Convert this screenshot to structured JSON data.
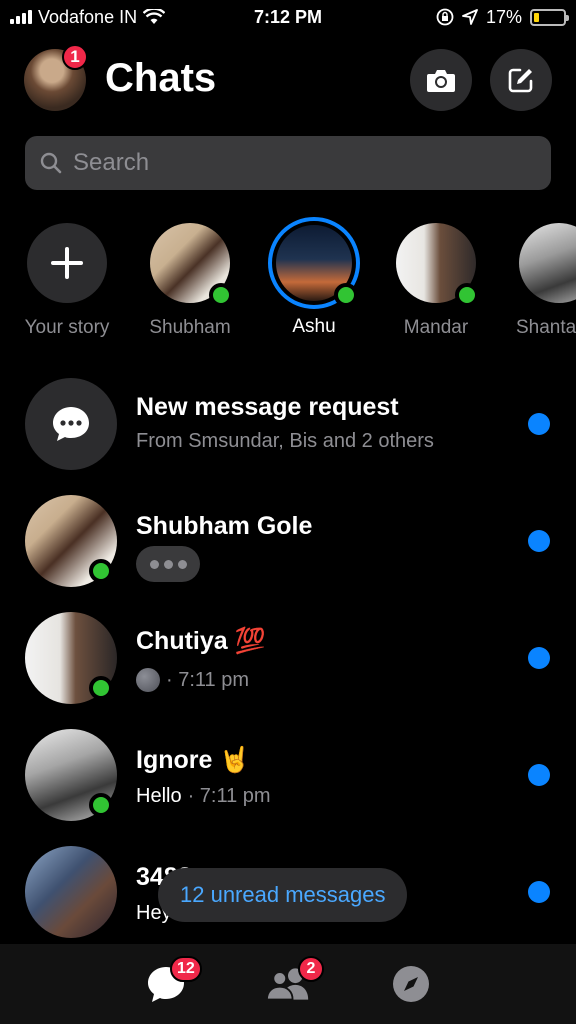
{
  "status_bar": {
    "carrier": "Vodafone IN",
    "time": "7:12 PM",
    "battery": "17%",
    "battery_level": 0.17
  },
  "header": {
    "title": "Chats",
    "profile_badge": "1"
  },
  "search": {
    "placeholder": "Search"
  },
  "stories": [
    {
      "label": "Your story"
    },
    {
      "label": "Shubham"
    },
    {
      "label": "Ashu"
    },
    {
      "label": "Mandar"
    },
    {
      "label": "Shanta"
    }
  ],
  "chats": [
    {
      "name": "New message request",
      "subtitle": "From Smsundar, Bis and 2 others"
    },
    {
      "name": "Shubham Gole"
    },
    {
      "name": "Chutiya",
      "emoji": "💯",
      "time": "· 7:11 pm"
    },
    {
      "name": "Ignore",
      "emoji": "🤘",
      "message": "Hello",
      "time": "· 7:11 pm"
    },
    {
      "name": "3488",
      "message": "Hey"
    }
  ],
  "unread_pill": "12 unread messages",
  "tabbar": {
    "chats_badge": "12",
    "people_badge": "2"
  },
  "colors": {
    "accent": "#0a84ff",
    "online": "#31c433",
    "badge": "#f02849",
    "surface": "#2c2c2e"
  }
}
